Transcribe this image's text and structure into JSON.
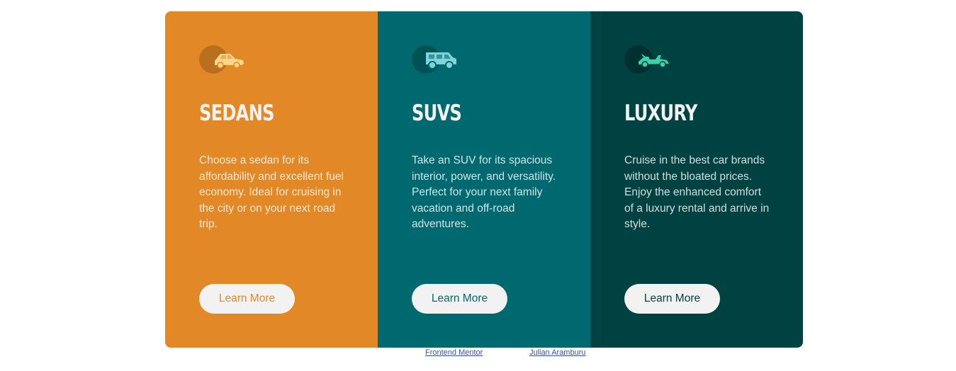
{
  "colors": {
    "sedans": "#e38826",
    "suvs": "#006970",
    "luxury": "#004241",
    "button_bg": "#f2f2f2",
    "link": "#3e52a3"
  },
  "cards": [
    {
      "id": "sedans",
      "icon": "sedan-car-icon",
      "title": "Sedans",
      "text": "Choose a sedan for its affordability and excellent fuel economy. Ideal for cruising in the city or on your next road trip.",
      "button_label": "Learn More"
    },
    {
      "id": "suvs",
      "icon": "suv-car-icon",
      "title": "SUVs",
      "text": "Take an SUV for its spacious interior, power, and versatility. Perfect for your next family vacation and off-road adventures.",
      "button_label": "Learn More"
    },
    {
      "id": "luxury",
      "icon": "luxury-convertible-icon",
      "title": "Luxury",
      "text": "Cruise in the best car brands without the bloated prices. Enjoy the enhanced comfort of a luxury rental and arrive in style.",
      "button_label": "Learn More"
    }
  ],
  "attribution": {
    "challenge_link": "Frontend Mentor",
    "author_link": "Julian Aramburu"
  }
}
